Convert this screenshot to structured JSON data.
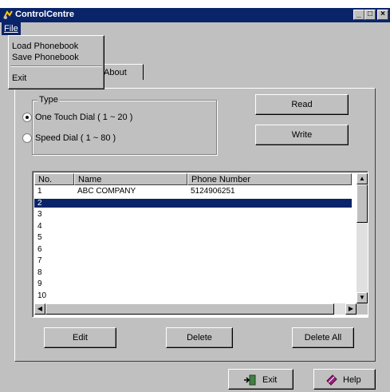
{
  "window": {
    "title": "ControlCentre",
    "minimize_glyph": "_",
    "maximize_glyph": "□",
    "close_glyph": "×"
  },
  "menubar": {
    "file_label": "File"
  },
  "file_menu": {
    "load_phonebook": "Load Phonebook",
    "save_phonebook": "Save Phonebook",
    "exit": "Exit"
  },
  "tab": {
    "about_label": "About",
    "icon": "about-icon"
  },
  "type_group": {
    "legend": "Type",
    "options": [
      {
        "label": "One Touch Dial ( 1 ~ 20 )",
        "selected": true
      },
      {
        "label": "Speed Dial ( 1 ~ 80 )",
        "selected": false
      }
    ]
  },
  "buttons": {
    "read": "Read",
    "write": "Write",
    "edit": "Edit",
    "delete": "Delete",
    "delete_all": "Delete All",
    "exit": "Exit",
    "help": "Help"
  },
  "phonebook": {
    "columns": [
      "No.",
      "Name",
      "Phone Number"
    ],
    "selected_row": 2,
    "rows": [
      {
        "no": "1",
        "name": "ABC COMPANY",
        "phone": "5124906251"
      },
      {
        "no": "2",
        "name": "",
        "phone": ""
      },
      {
        "no": "3",
        "name": "",
        "phone": ""
      },
      {
        "no": "4",
        "name": "",
        "phone": ""
      },
      {
        "no": "5",
        "name": "",
        "phone": ""
      },
      {
        "no": "6",
        "name": "",
        "phone": ""
      },
      {
        "no": "7",
        "name": "",
        "phone": ""
      },
      {
        "no": "8",
        "name": "",
        "phone": ""
      },
      {
        "no": "9",
        "name": "",
        "phone": ""
      },
      {
        "no": "10",
        "name": "",
        "phone": ""
      }
    ]
  },
  "colors": {
    "titlebar": "#0a246a",
    "selection": "#0a246a",
    "face": "#c0c0c0"
  }
}
